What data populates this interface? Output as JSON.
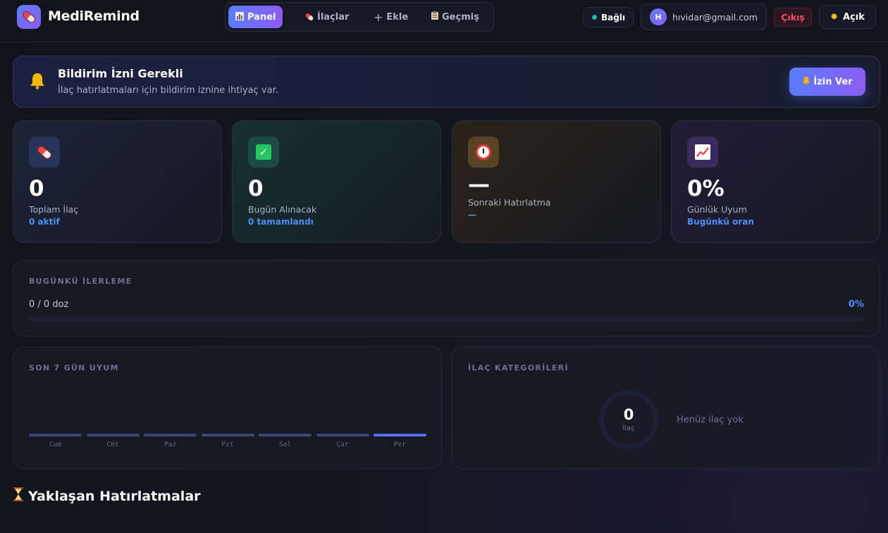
{
  "app": {
    "name": "MediRemind"
  },
  "nav": {
    "items": [
      {
        "label": "Panel",
        "icon": "bar-chart-icon",
        "active": true
      },
      {
        "label": "İlaçlar",
        "icon": "pill-icon",
        "active": false
      },
      {
        "label": "Ekle",
        "icon": "plus-icon",
        "active": false
      },
      {
        "label": "Geçmiş",
        "icon": "clipboard-icon",
        "active": false
      }
    ]
  },
  "header": {
    "status": "Bağlı",
    "user_initial": "H",
    "user_email": "hıvidar@gmail.com",
    "logout": "Çıkış",
    "theme": "Açık"
  },
  "banner": {
    "title": "Bildirim İzni Gerekli",
    "subtitle": "İlaç hatırlatmaları için bildirim iznine ihtiyaç var.",
    "button": "İzin Ver"
  },
  "stats": [
    {
      "icon": "pill-icon",
      "value": "0",
      "label": "Toplam İlaç",
      "sub": "0 aktif"
    },
    {
      "icon": "check-icon",
      "value": "0",
      "label": "Bugün Alınacak",
      "sub": "0 tamamlandı"
    },
    {
      "icon": "alarm-clock-icon",
      "value": "—",
      "label": "Sonraki Hatırlatma",
      "sub": "—"
    },
    {
      "icon": "trend-chart-icon",
      "value": "0%",
      "label": "Günlük Uyum",
      "sub": "Bugünkü oran"
    }
  ],
  "progress": {
    "title": "BUGÜNKÜ İLERLEME",
    "doses": "0 / 0 doz",
    "percent_label": "0%",
    "fraction": 0
  },
  "weekly": {
    "title": "SON 7 GÜN UYUM",
    "days": [
      "Cum",
      "Cmt",
      "Paz",
      "Pzt",
      "Sal",
      "Çar",
      "Per"
    ]
  },
  "categories": {
    "title": "İLAÇ KATEGORİLERİ",
    "count": "0",
    "count_label": "İlaç",
    "empty": "Henüz ilaç yok"
  },
  "upcoming": {
    "title": "Yaklaşan Hatırlatmalar"
  },
  "colors": {
    "accent_start": "#5b7cfa",
    "accent_end": "#8b5cf6",
    "link_blue": "#4f8ef7",
    "danger": "#ff4d6d"
  }
}
